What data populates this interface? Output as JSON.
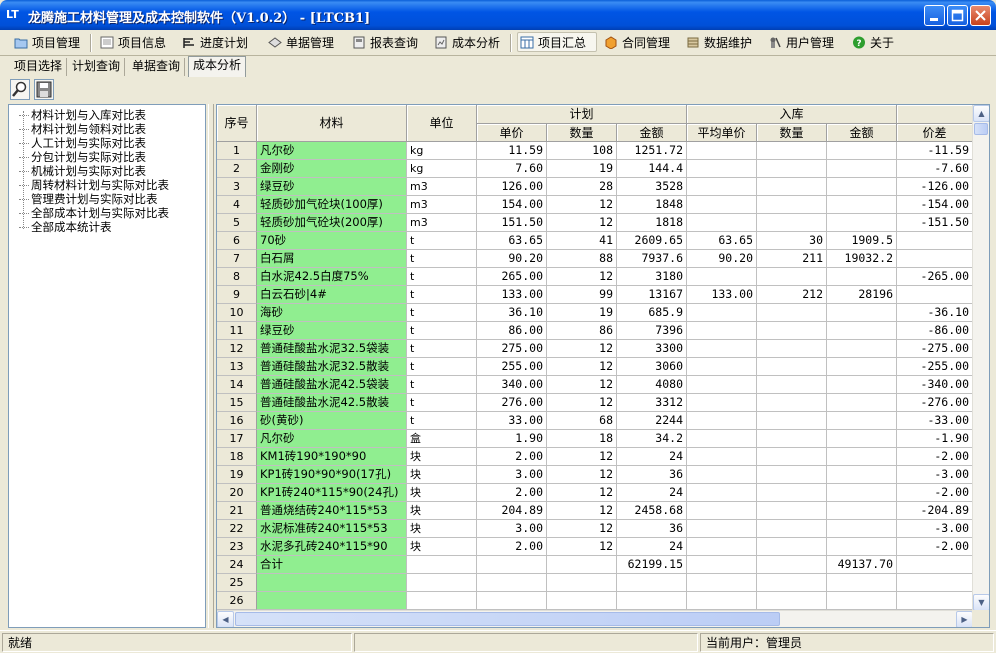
{
  "window": {
    "app_icon": "LT",
    "title": "龙腾施工材料管理及成本控制软件（V1.0.2） - [LTCB1]"
  },
  "toolbar": [
    {
      "label": "项目管理",
      "icon": "folder-icon"
    },
    {
      "label": "项目信息",
      "icon": "document-icon"
    },
    {
      "label": "进度计划",
      "icon": "schedule-icon"
    },
    {
      "label": "单据管理",
      "icon": "diamond-icon"
    },
    {
      "label": "报表查询",
      "icon": "report-icon"
    },
    {
      "label": "成本分析",
      "icon": "analysis-icon"
    },
    {
      "label": "项目汇总",
      "icon": "summary-icon"
    },
    {
      "label": "合同管理",
      "icon": "contract-icon"
    },
    {
      "label": "数据维护",
      "icon": "database-icon"
    },
    {
      "label": "用户管理",
      "icon": "user-icon"
    },
    {
      "label": "关于",
      "icon": "help-icon"
    }
  ],
  "tabs": [
    "项目选择",
    "计划查询",
    "单据查询",
    "成本分析"
  ],
  "active_tab": "成本分析",
  "tool_buttons": [
    "search-icon",
    "save-icon"
  ],
  "tree": [
    "材料计划与入库对比表",
    "材料计划与领料对比表",
    "人工计划与实际对比表",
    "分包计划与实际对比表",
    "机械计划与实际对比表",
    "周转材料计划与实际对比表",
    "管理费计划与实际对比表",
    "全部成本计划与实际对比表",
    "全部成本统计表"
  ],
  "grid": {
    "headers": {
      "seq": "序号",
      "material": "材料",
      "unit": "单位",
      "plan": "计划",
      "stock": "入库",
      "plan_price": "单价",
      "plan_qty": "数量",
      "plan_amount": "金额",
      "stock_avg_price": "平均单价",
      "stock_qty": "数量",
      "stock_amount": "金额",
      "price_diff": "价差"
    },
    "rows": [
      {
        "seq": "1",
        "material": "凡尔砂",
        "unit": "kg",
        "price": "11.59",
        "qty": "108",
        "amount": "1251.72",
        "avg": "",
        "sqty": "",
        "samount": "",
        "diff": "-11.59"
      },
      {
        "seq": "2",
        "material": "金刚砂",
        "unit": "kg",
        "price": "7.60",
        "qty": "19",
        "amount": "144.4",
        "avg": "",
        "sqty": "",
        "samount": "",
        "diff": "-7.60"
      },
      {
        "seq": "3",
        "material": "绿豆砂",
        "unit": "m3",
        "price": "126.00",
        "qty": "28",
        "amount": "3528",
        "avg": "",
        "sqty": "",
        "samount": "",
        "diff": "-126.00"
      },
      {
        "seq": "4",
        "material": "轻质砂加气砼块(100厚)",
        "unit": "m3",
        "price": "154.00",
        "qty": "12",
        "amount": "1848",
        "avg": "",
        "sqty": "",
        "samount": "",
        "diff": "-154.00"
      },
      {
        "seq": "5",
        "material": "轻质砂加气砼块(200厚)",
        "unit": "m3",
        "price": "151.50",
        "qty": "12",
        "amount": "1818",
        "avg": "",
        "sqty": "",
        "samount": "",
        "diff": "-151.50"
      },
      {
        "seq": "6",
        "material": "70砂",
        "unit": "t",
        "price": "63.65",
        "qty": "41",
        "amount": "2609.65",
        "avg": "63.65",
        "sqty": "30",
        "samount": "1909.5",
        "diff": ""
      },
      {
        "seq": "7",
        "material": "白石屑",
        "unit": "t",
        "price": "90.20",
        "qty": "88",
        "amount": "7937.6",
        "avg": "90.20",
        "sqty": "211",
        "samount": "19032.2",
        "diff": ""
      },
      {
        "seq": "8",
        "material": "白水泥42.5白度75%",
        "unit": "t",
        "price": "265.00",
        "qty": "12",
        "amount": "3180",
        "avg": "",
        "sqty": "",
        "samount": "",
        "diff": "-265.00"
      },
      {
        "seq": "9",
        "material": "白云石砂|4#",
        "unit": "t",
        "price": "133.00",
        "qty": "99",
        "amount": "13167",
        "avg": "133.00",
        "sqty": "212",
        "samount": "28196",
        "diff": ""
      },
      {
        "seq": "10",
        "material": "海砂",
        "unit": "t",
        "price": "36.10",
        "qty": "19",
        "amount": "685.9",
        "avg": "",
        "sqty": "",
        "samount": "",
        "diff": "-36.10"
      },
      {
        "seq": "11",
        "material": "绿豆砂",
        "unit": "t",
        "price": "86.00",
        "qty": "86",
        "amount": "7396",
        "avg": "",
        "sqty": "",
        "samount": "",
        "diff": "-86.00"
      },
      {
        "seq": "12",
        "material": "普通硅酸盐水泥32.5袋装",
        "unit": "t",
        "price": "275.00",
        "qty": "12",
        "amount": "3300",
        "avg": "",
        "sqty": "",
        "samount": "",
        "diff": "-275.00"
      },
      {
        "seq": "13",
        "material": "普通硅酸盐水泥32.5散装",
        "unit": "t",
        "price": "255.00",
        "qty": "12",
        "amount": "3060",
        "avg": "",
        "sqty": "",
        "samount": "",
        "diff": "-255.00"
      },
      {
        "seq": "14",
        "material": "普通硅酸盐水泥42.5袋装",
        "unit": "t",
        "price": "340.00",
        "qty": "12",
        "amount": "4080",
        "avg": "",
        "sqty": "",
        "samount": "",
        "diff": "-340.00"
      },
      {
        "seq": "15",
        "material": "普通硅酸盐水泥42.5散装",
        "unit": "t",
        "price": "276.00",
        "qty": "12",
        "amount": "3312",
        "avg": "",
        "sqty": "",
        "samount": "",
        "diff": "-276.00"
      },
      {
        "seq": "16",
        "material": "砂(黄砂)",
        "unit": "t",
        "price": "33.00",
        "qty": "68",
        "amount": "2244",
        "avg": "",
        "sqty": "",
        "samount": "",
        "diff": "-33.00"
      },
      {
        "seq": "17",
        "material": "凡尔砂",
        "unit": "盒",
        "price": "1.90",
        "qty": "18",
        "amount": "34.2",
        "avg": "",
        "sqty": "",
        "samount": "",
        "diff": "-1.90"
      },
      {
        "seq": "18",
        "material": "KM1砖190*190*90",
        "unit": "块",
        "price": "2.00",
        "qty": "12",
        "amount": "24",
        "avg": "",
        "sqty": "",
        "samount": "",
        "diff": "-2.00"
      },
      {
        "seq": "19",
        "material": "KP1砖190*90*90(17孔)",
        "unit": "块",
        "price": "3.00",
        "qty": "12",
        "amount": "36",
        "avg": "",
        "sqty": "",
        "samount": "",
        "diff": "-3.00"
      },
      {
        "seq": "20",
        "material": "KP1砖240*115*90(24孔)",
        "unit": "块",
        "price": "2.00",
        "qty": "12",
        "amount": "24",
        "avg": "",
        "sqty": "",
        "samount": "",
        "diff": "-2.00"
      },
      {
        "seq": "21",
        "material": "普通烧结砖240*115*53",
        "unit": "块",
        "price": "204.89",
        "qty": "12",
        "amount": "2458.68",
        "avg": "",
        "sqty": "",
        "samount": "",
        "diff": "-204.89"
      },
      {
        "seq": "22",
        "material": "水泥标准砖240*115*53",
        "unit": "块",
        "price": "3.00",
        "qty": "12",
        "amount": "36",
        "avg": "",
        "sqty": "",
        "samount": "",
        "diff": "-3.00"
      },
      {
        "seq": "23",
        "material": "水泥多孔砖240*115*90",
        "unit": "块",
        "price": "2.00",
        "qty": "12",
        "amount": "24",
        "avg": "",
        "sqty": "",
        "samount": "",
        "diff": "-2.00"
      },
      {
        "seq": "24",
        "material": "合计",
        "unit": "",
        "price": "",
        "qty": "",
        "amount": "62199.15",
        "avg": "",
        "sqty": "",
        "samount": "49137.70",
        "diff": ""
      },
      {
        "seq": "25",
        "material": "",
        "unit": "",
        "price": "",
        "qty": "",
        "amount": "",
        "avg": "",
        "sqty": "",
        "samount": "",
        "diff": ""
      },
      {
        "seq": "26",
        "material": "",
        "unit": "",
        "price": "",
        "qty": "",
        "amount": "",
        "avg": "",
        "sqty": "",
        "samount": "",
        "diff": ""
      }
    ]
  },
  "statusbar": {
    "status": "就绪",
    "middle": "",
    "user": "当前用户：管理员"
  },
  "colors": {
    "material_cell_bg": "#90EE90",
    "titlebar": "#0055E5",
    "chrome": "#ECE9D8"
  }
}
